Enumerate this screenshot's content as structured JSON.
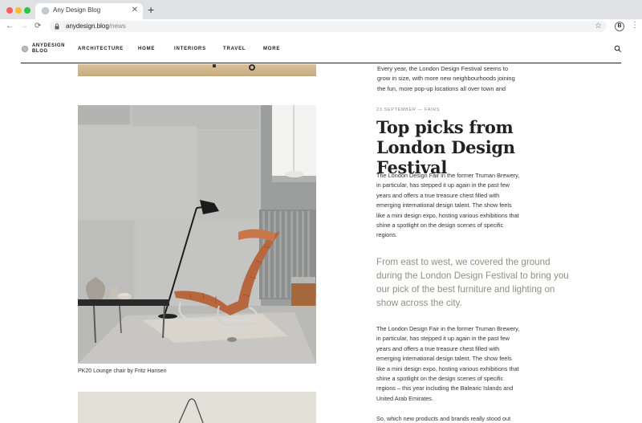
{
  "browser": {
    "tab_title": "Any Design Blog",
    "tab_close": "✕",
    "new_tab": "+",
    "url_domain": "anydesign.blog",
    "url_path": "/news",
    "back": "←",
    "forward": "→",
    "reload": "⟳",
    "star": "☆",
    "extension_label": "B",
    "menu": "⋮"
  },
  "site": {
    "logo_line1": "ANYDESIGN",
    "logo_line2": "BLOG",
    "nav": [
      "ARCHITECTURE",
      "HOME",
      "INTERIORS",
      "TRAVEL",
      "MORE"
    ]
  },
  "intro": "Every year, the London Design Festival seems to grow in size, with more new neighbourhoods joining the fun, more pop-up locations all over town and",
  "article": {
    "meta": "23 SEPTEMBER — FAIRS",
    "headline": "Top picks from London Design Festival",
    "caption": "PK20 Lounge chair by Fritz Hansen",
    "para1": "The London Design Fair in the former Truman Brewery, in particular, has stepped it up again in the past few years and offers a true treasure chest filled with emerging international design talent. The show feels like a mini design expo, hosting various exhibitions that shine a spotlight on the design scenes of specific regions.",
    "pullquote": "From east to west, we covered the ground during the London Design Festival to bring you our pick of the best furniture and lighting on show across the city.",
    "para2": "The London Design Fair in the former Truman Brewery, in particular, has stepped it up again in the past few years and offers a true treasure chest filled with emerging international design talent. The show feels like a mini design expo, hosting various exhibitions that shine a spotlight on the design scenes of specific regions – this year including the Balearic Islands and United Arab Emirates.",
    "para3": "So,  which new products and brands really stood out"
  },
  "colors": {
    "tabbar": "#dfe1e5",
    "pullquote": "#8f8f82",
    "accent_leather": "#b8663d"
  }
}
